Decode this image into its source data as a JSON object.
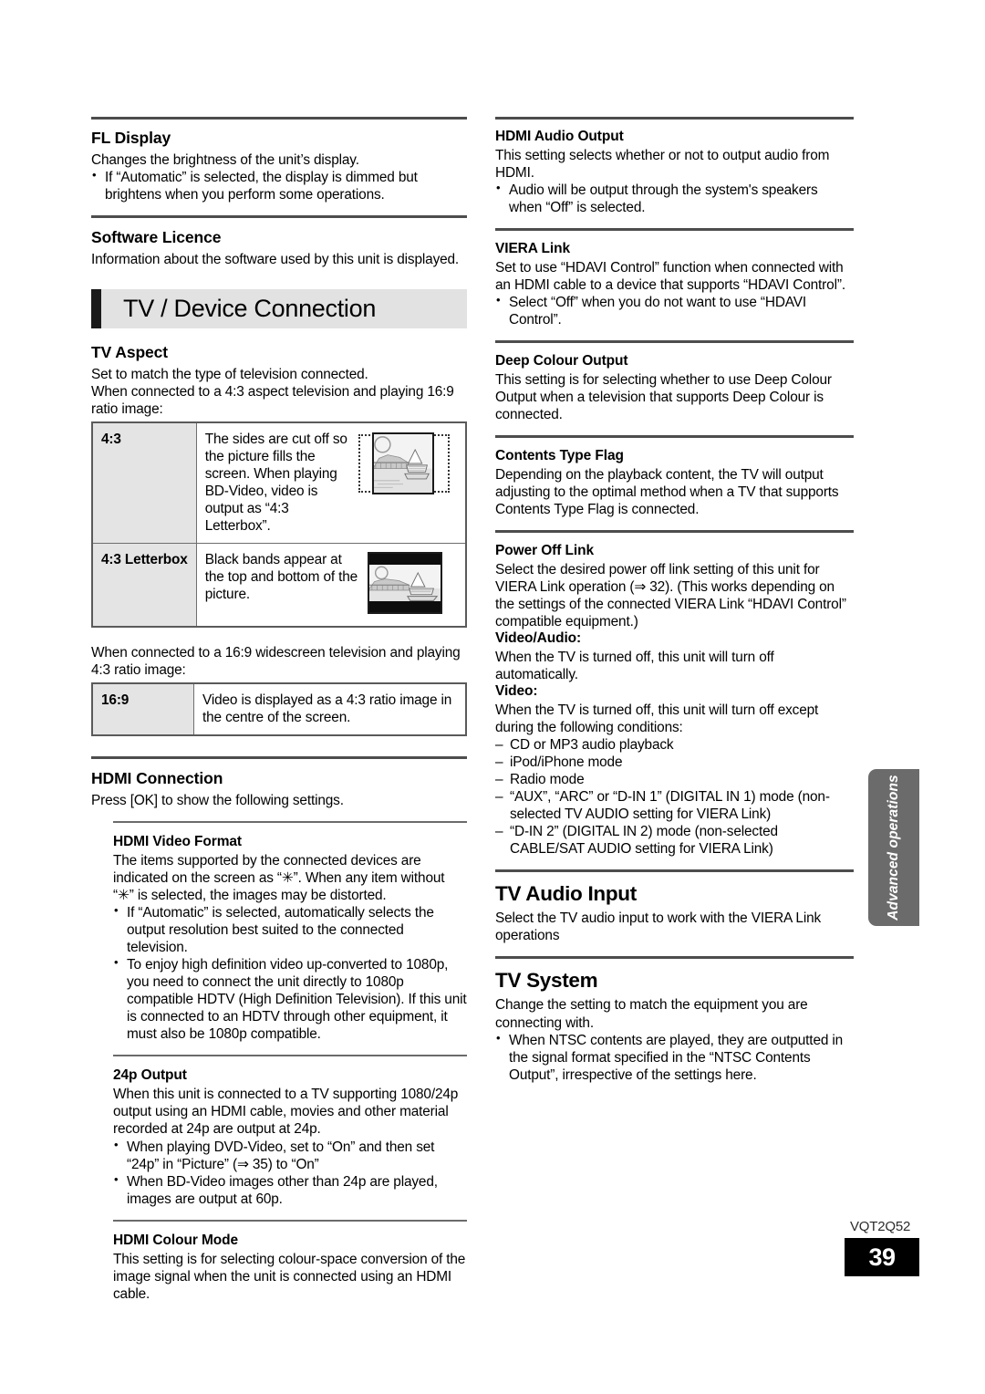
{
  "document": {
    "code": "VQT2Q52",
    "page_number": "39",
    "side_tab_label": "Advanced operations"
  },
  "left_column": {
    "fl_display": {
      "heading": "FL Display",
      "body": "Changes the brightness of the unit’s display.",
      "bullets": [
        "If “Automatic” is selected, the display is dimmed but brightens when you perform some operations."
      ]
    },
    "software_licence": {
      "heading": "Software Licence",
      "body": "Information about the software used by this unit is displayed."
    },
    "banner": {
      "title": "TV / Device Connection"
    },
    "tv_aspect": {
      "heading": "TV Aspect",
      "body1": "Set to match the type of television connected.",
      "body2": "When connected to a 4:3 aspect television and playing 16:9 ratio image:",
      "table1": [
        {
          "label": "4:3",
          "desc": "The sides are cut off so the picture fills the screen. When playing BD-Video, video is output as “4:3 Letterbox”.",
          "illustration": "bridge-boat-cropped-sides-image"
        },
        {
          "label": "4:3 Letterbox",
          "desc": "Black bands appear at the top and bottom of the picture.",
          "illustration": "bridge-boat-letterbox-image"
        }
      ],
      "body3": "When connected to a 16:9 widescreen television and playing 4:3 ratio image:",
      "table2": [
        {
          "label": "16:9",
          "desc": "Video is displayed as a 4:3 ratio image in the centre of the screen."
        }
      ]
    },
    "hdmi_connection": {
      "heading": "HDMI Connection",
      "body": "Press [OK] to show the following settings.",
      "subsections": [
        {
          "heading": "HDMI Video Format",
          "body": "The items supported by the connected devices are indicated on the screen as “✳”. When any item without “✳” is selected, the images may be distorted.",
          "bullets": [
            "If “Automatic” is selected, automatically selects the output resolution best suited to the connected television.",
            "To enjoy high definition video up-converted to 1080p, you need to connect the unit directly to 1080p compatible HDTV (High Definition Television). If this unit is connected to an HDTV through other equipment, it must also be 1080p compatible."
          ]
        },
        {
          "heading": "24p Output",
          "body": "When this unit is connected to a TV supporting 1080/24p output using an HDMI cable, movies and other material recorded at 24p are output at 24p.",
          "bullets": [
            "When playing DVD-Video, set to “On” and then set “24p” in “Picture” (⇒ 35) to “On”",
            "When BD-Video images other than 24p are played, images are output at 60p."
          ]
        },
        {
          "heading": "HDMI Colour Mode",
          "body": "This setting is for selecting colour-space conversion of the image signal when the unit is connected using an HDMI cable.",
          "bullets": []
        }
      ]
    }
  },
  "right_column": {
    "hdmi_audio_output": {
      "heading": "HDMI Audio Output",
      "body": "This setting selects whether or not to output audio from HDMI.",
      "bullets": [
        "Audio will be output through the system's speakers when “Off” is selected."
      ]
    },
    "viera_link": {
      "heading": "VIERA Link",
      "body": "Set to use “HDAVI Control” function when connected with an HDMI cable to a device that supports “HDAVI Control”.",
      "bullets": [
        "Select “Off” when you do not want to use “HDAVI Control”."
      ]
    },
    "deep_colour_output": {
      "heading": "Deep Colour Output",
      "body": "This setting is for selecting whether to use Deep Colour Output when a television that supports Deep Colour is connected."
    },
    "contents_type_flag": {
      "heading": "Contents Type Flag",
      "body": "Depending on the playback content, the TV will output adjusting to the optimal method when a TV that supports Contents Type Flag is connected."
    },
    "power_off_link": {
      "heading": "Power Off Link",
      "body": "Select the desired power off link setting of this unit for VIERA Link operation (⇒ 32). (This works depending on the settings of the connected VIERA Link “HDAVI Control” compatible equipment.)",
      "video_audio_label": "Video/Audio:",
      "video_audio_body": "When the TV is turned off, this unit will turn off automatically.",
      "video_label": "Video:",
      "video_body": "When the TV is turned off, this unit will turn off except during the following conditions:",
      "conditions": [
        "CD or MP3 audio playback",
        "iPod/iPhone mode",
        "Radio mode",
        "“AUX”, “ARC” or “D-IN 1” (DIGITAL IN 1) mode (non-selected TV AUDIO setting for VIERA Link)",
        "“D-IN 2” (DIGITAL IN 2) mode (non-selected CABLE/SAT AUDIO setting for VIERA Link)"
      ]
    },
    "tv_audio_input": {
      "heading": "TV Audio Input",
      "body": "Select the TV audio input to work with the VIERA Link operations"
    },
    "tv_system": {
      "heading": "TV System",
      "body": "Change the setting to match the equipment you are connecting with.",
      "bullets": [
        "When NTSC contents are played, they are outputted in the signal format specified in the “NTSC Contents Output”, irrespective of the settings here."
      ]
    }
  }
}
